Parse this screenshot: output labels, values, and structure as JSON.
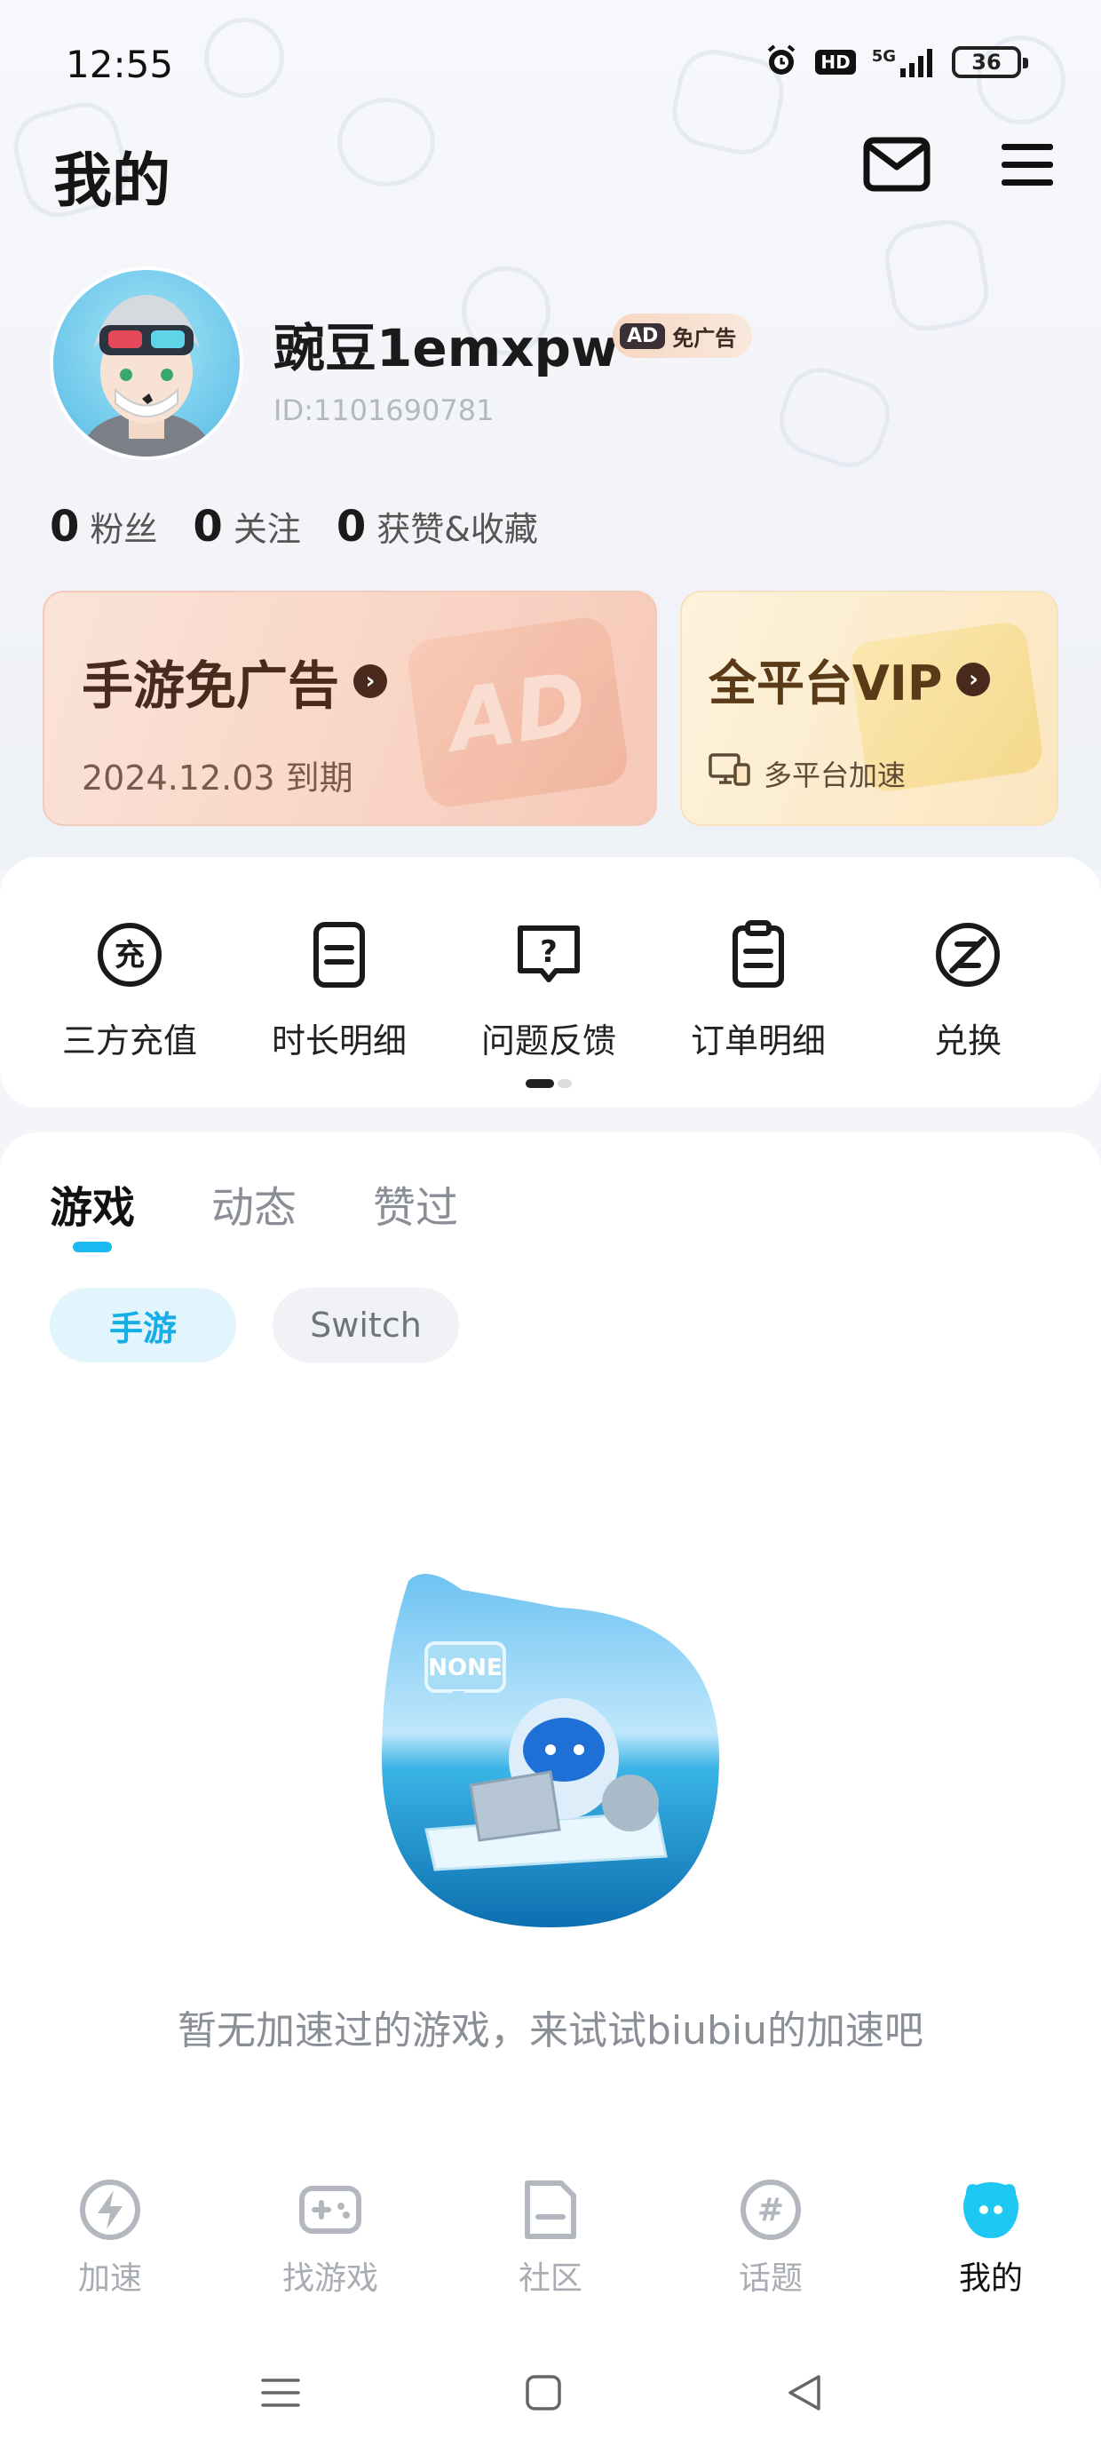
{
  "status_bar": {
    "time": "12:55",
    "network": "5G",
    "hd": "HD",
    "battery": "36"
  },
  "header": {
    "title": "我的"
  },
  "profile": {
    "username": "豌豆1emxpw",
    "badge_ad": "AD",
    "badge_text": "免广告",
    "user_id": "ID:1101690781"
  },
  "stats": [
    {
      "count": "0",
      "label": "粉丝"
    },
    {
      "count": "0",
      "label": "关注"
    },
    {
      "count": "0",
      "label": "获赞&收藏"
    }
  ],
  "promo": {
    "ad_free": {
      "title": "手游免广告",
      "expiry": "2024.12.03 到期",
      "art_text": "AD"
    },
    "vip": {
      "title": "全平台VIP",
      "subtitle": "多平台加速"
    }
  },
  "quick_actions": [
    {
      "label": "三方充值",
      "icon": "recharge-icon",
      "glyph": "充"
    },
    {
      "label": "时长明细",
      "icon": "duration-detail-icon"
    },
    {
      "label": "问题反馈",
      "icon": "feedback-icon",
      "glyph": "?"
    },
    {
      "label": "订单明细",
      "icon": "order-detail-icon"
    },
    {
      "label": "兑换",
      "icon": "redeem-icon"
    }
  ],
  "content_tabs": [
    {
      "label": "游戏",
      "active": true
    },
    {
      "label": "动态",
      "active": false
    },
    {
      "label": "赞过",
      "active": false
    }
  ],
  "filter_chips": [
    {
      "label": "手游",
      "active": true
    },
    {
      "label": "Switch",
      "active": false
    }
  ],
  "empty_state": {
    "art_label": "NONE",
    "message": "暂无加速过的游戏，来试试biubiu的加速吧"
  },
  "bottom_nav": [
    {
      "label": "加速",
      "icon": "lightning-icon",
      "active": false
    },
    {
      "label": "找游戏",
      "icon": "gamepad-icon",
      "active": false
    },
    {
      "label": "社区",
      "icon": "document-icon",
      "active": false
    },
    {
      "label": "话题",
      "icon": "hashtag-icon",
      "glyph": "#",
      "active": false
    },
    {
      "label": "我的",
      "icon": "mascot-icon",
      "active": true
    }
  ],
  "colors": {
    "accent": "#1bb9ef",
    "ad_card": "#f9d4c5",
    "vip_card": "#fbe6bf",
    "text_primary": "#111111",
    "text_muted": "#8a8e96"
  }
}
